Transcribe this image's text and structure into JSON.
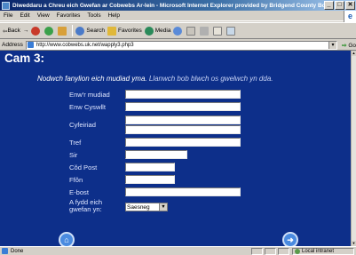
{
  "window": {
    "title": "Diweddaru a Chreu eich Gwefan ar Cobwebs Ar-lein - Microsoft Internet Explorer provided by Bridgend County Borough Council",
    "buttons": {
      "minimize": "_",
      "maximize": "□",
      "close": "✕"
    }
  },
  "menu": [
    "File",
    "Edit",
    "View",
    "Favorites",
    "Tools",
    "Help"
  ],
  "toolbar": {
    "back": "Back",
    "forward": "→",
    "search": "Search",
    "favorites": "Favorites",
    "media": "Media"
  },
  "address": {
    "label": "Address",
    "url": "http://www.cobwebs.uk.net/wapply3.php3",
    "go": "Go"
  },
  "page": {
    "heading": "Cam 3:",
    "intro": "Nodwch fanylion eich mudiad yma.",
    "intro_sub": "Llanwch bob blwch os gwelwch yn dda.",
    "fields": {
      "org_name": "Enw'r mudiad",
      "contact_name": "Enw Cyswllt",
      "address": "Cyfeiriad",
      "town": "Tref",
      "county": "Sir",
      "postcode": "Cŏd Post",
      "phone": "Ffôn",
      "email": "E-bost",
      "language": "A fydd eich gwefan yn:"
    },
    "language_options": {
      "selected": "Saesneg"
    },
    "nav": {
      "home": "⌂",
      "next": "➜"
    }
  },
  "status": {
    "text": "Done",
    "zone": "Local intranet"
  },
  "colors": {
    "page_bg": "#0d2f8a",
    "label": "#dfe6ff",
    "nav_button": "#4a8be0"
  }
}
